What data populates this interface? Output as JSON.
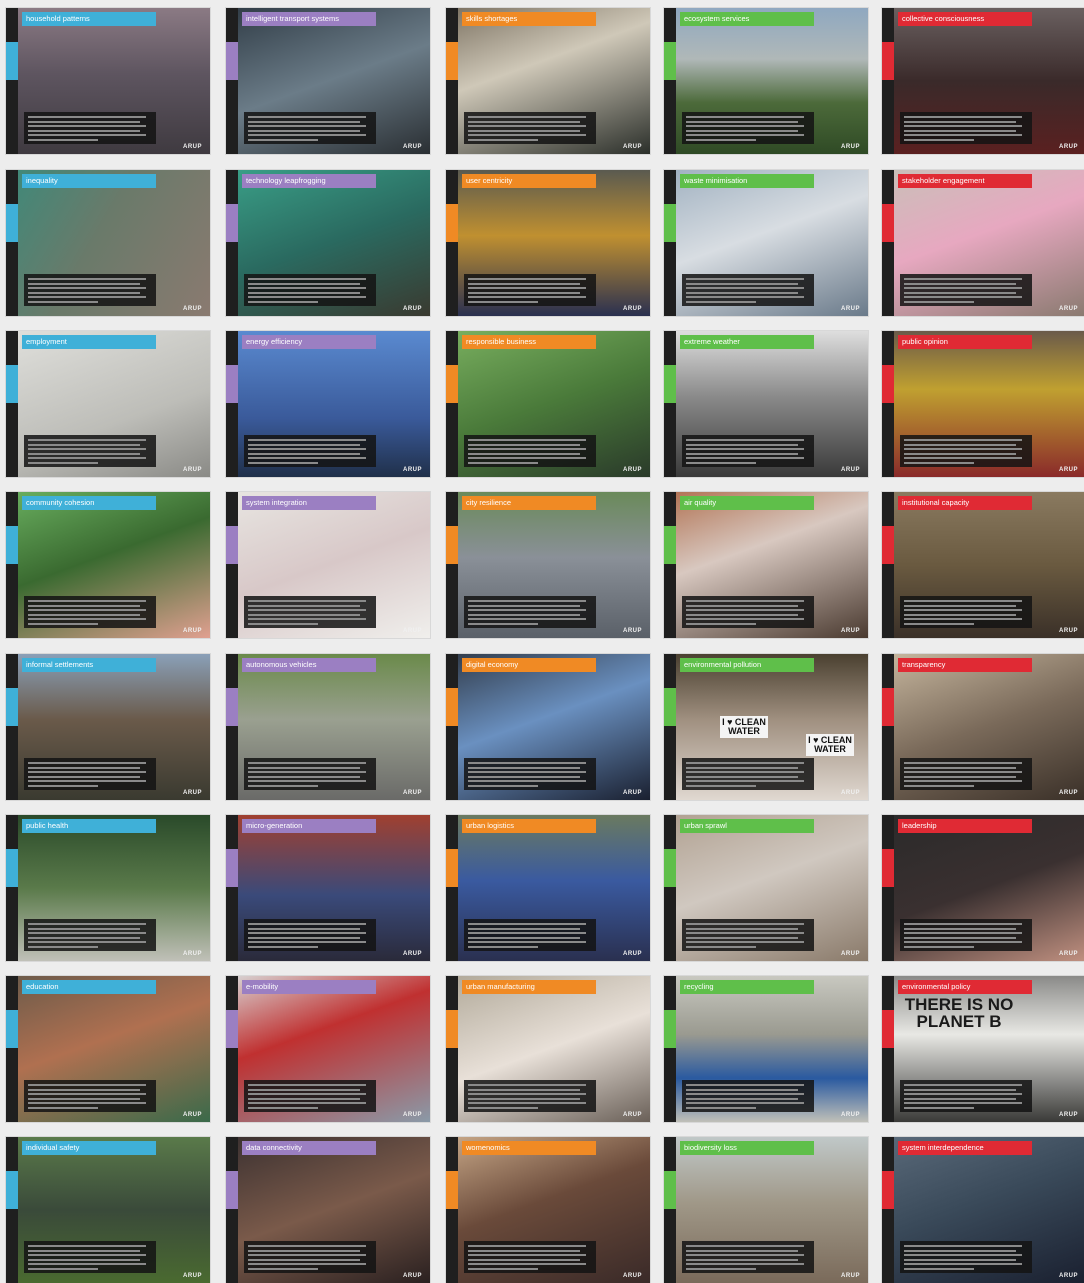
{
  "colors": {
    "blue": "#3fb0d8",
    "purple": "#9b7fc2",
    "orange": "#f08a24",
    "green": "#5fbf4a",
    "red": "#e02a34"
  },
  "logo_text": "ARUP",
  "columns": [
    "blue",
    "purple",
    "orange",
    "green",
    "red"
  ],
  "rows": [
    [
      "household patterns",
      "intelligent transport systems",
      "skills shortages",
      "ecosystem services",
      "collective consciousness"
    ],
    [
      "inequality",
      "technology leapfrogging",
      "user centricity",
      "waste minimisation",
      "stakeholder engagement"
    ],
    [
      "employment",
      "energy efficiency",
      "responsible business",
      "extreme weather",
      "public opinion"
    ],
    [
      "community cohesion",
      "system integration",
      "city resilience",
      "air quality",
      "institutional capacity"
    ],
    [
      "informal settlements",
      "autonomous vehicles",
      "digital economy",
      "environmental pollution",
      "transparency"
    ],
    [
      "public health",
      "micro-generation",
      "urban logistics",
      "urban sprawl",
      "leadership"
    ],
    [
      "education",
      "e-mobility",
      "urban manufacturing",
      "recycling",
      "environmental policy"
    ],
    [
      "individual safety",
      "data connectivity",
      "womenomics",
      "biodiversity loss",
      "system interdependence"
    ]
  ],
  "photo_text": {
    "clean_water": "I ♥ CLEAN WATER",
    "planet_b": "THERE IS NO PLANET B"
  }
}
